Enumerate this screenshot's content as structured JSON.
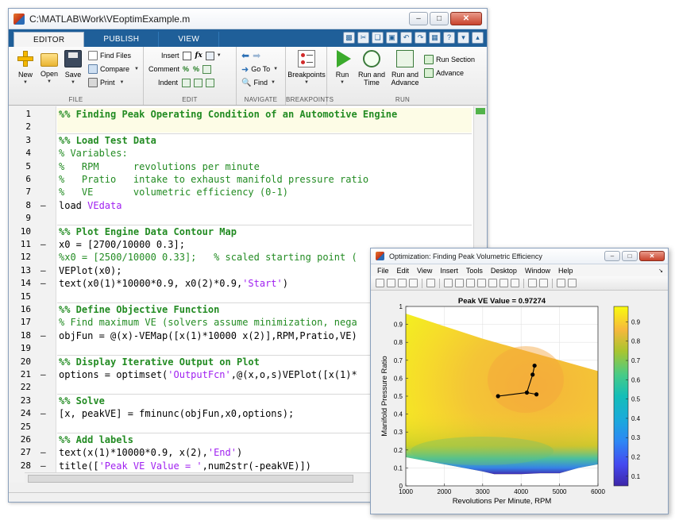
{
  "editor_window": {
    "title": "C:\\MATLAB\\Work\\VEoptimExample.m",
    "tabs": [
      {
        "label": "EDITOR",
        "active": true
      },
      {
        "label": "PUBLISH",
        "active": false
      },
      {
        "label": "VIEW",
        "active": false
      }
    ],
    "ribbon": {
      "file": {
        "group_label": "FILE",
        "new_label": "New",
        "open_label": "Open",
        "save_label": "Save",
        "find_files_label": "Find Files",
        "compare_label": "Compare",
        "print_label": "Print"
      },
      "edit": {
        "group_label": "EDIT",
        "insert_label": "Insert",
        "comment_label": "Comment",
        "indent_label": "Indent",
        "fx_label": "fx"
      },
      "navigate": {
        "group_label": "NAVIGATE",
        "goto_label": "Go To",
        "find_label": "Find"
      },
      "breakpoints": {
        "group_label": "BREAKPOINTS",
        "breakpoints_label": "Breakpoints"
      },
      "run": {
        "group_label": "RUN",
        "run_label": "Run",
        "run_and_time_line1": "Run and",
        "run_and_time_line2": "Time",
        "run_and_advance_line1": "Run and",
        "run_and_advance_line2": "Advance",
        "run_section_label": "Run Section",
        "advance_label": "Advance"
      }
    },
    "code_lines": [
      {
        "num": "1",
        "dash": false,
        "text": "%% Finding Peak Operating Condition of an Automotive Engine",
        "kind": "cell"
      },
      {
        "num": "2",
        "dash": false,
        "text": "",
        "kind": "code"
      },
      {
        "num": "3",
        "dash": false,
        "text": "%% Load Test Data",
        "kind": "cell"
      },
      {
        "num": "4",
        "dash": false,
        "text": "% Variables:",
        "kind": "comment"
      },
      {
        "num": "5",
        "dash": false,
        "text": "%   RPM      revolutions per minute",
        "kind": "comment"
      },
      {
        "num": "6",
        "dash": false,
        "text": "%   Pratio   intake to exhaust manifold pressure ratio",
        "kind": "comment"
      },
      {
        "num": "7",
        "dash": false,
        "text": "%   VE       volumetric efficiency (0-1)",
        "kind": "comment"
      },
      {
        "num": "8",
        "dash": true,
        "parts": [
          {
            "t": "load ",
            "k": "code"
          },
          {
            "t": "VEdata",
            "k": "string"
          }
        ],
        "kind": "mixed"
      },
      {
        "num": "9",
        "dash": false,
        "text": "",
        "kind": "code"
      },
      {
        "num": "10",
        "dash": false,
        "text": "%% Plot Engine Data Contour Map",
        "kind": "cell"
      },
      {
        "num": "11",
        "dash": true,
        "text": "x0 = [2700/10000 0.3];",
        "kind": "code"
      },
      {
        "num": "12",
        "dash": false,
        "text": "%x0 = [2500/10000 0.33];   % scaled starting point (",
        "kind": "comment"
      },
      {
        "num": "13",
        "dash": true,
        "text": "VEPlot(x0);",
        "kind": "code"
      },
      {
        "num": "14",
        "dash": true,
        "parts": [
          {
            "t": "text(x0(1)*10000*0.9, x0(2)*0.9,",
            "k": "code"
          },
          {
            "t": "'Start'",
            "k": "string"
          },
          {
            "t": ")",
            "k": "code"
          }
        ],
        "kind": "mixed"
      },
      {
        "num": "15",
        "dash": false,
        "text": "",
        "kind": "code"
      },
      {
        "num": "16",
        "dash": false,
        "text": "%% Define Objective Function",
        "kind": "cell"
      },
      {
        "num": "17",
        "dash": false,
        "text": "% Find maximum VE (solvers assume minimization, nega",
        "kind": "comment"
      },
      {
        "num": "18",
        "dash": true,
        "text": "objFun = @(x)-VEMap([x(1)*10000 x(2)],RPM,Pratio,VE)",
        "kind": "code"
      },
      {
        "num": "19",
        "dash": false,
        "text": "",
        "kind": "code"
      },
      {
        "num": "20",
        "dash": false,
        "text": "%% Display Iterative Output on Plot",
        "kind": "cell"
      },
      {
        "num": "21",
        "dash": true,
        "parts": [
          {
            "t": "options = optimset(",
            "k": "code"
          },
          {
            "t": "'OutputFcn'",
            "k": "string"
          },
          {
            "t": ",@(x,o,s)VEPlot([x(1)*",
            "k": "code"
          }
        ],
        "kind": "mixed"
      },
      {
        "num": "22",
        "dash": false,
        "text": "",
        "kind": "code"
      },
      {
        "num": "23",
        "dash": false,
        "text": "%% Solve",
        "kind": "cell"
      },
      {
        "num": "24",
        "dash": true,
        "text": "[x, peakVE] = fminunc(objFun,x0,options);",
        "kind": "code"
      },
      {
        "num": "25",
        "dash": false,
        "text": "",
        "kind": "code"
      },
      {
        "num": "26",
        "dash": false,
        "text": "%% Add labels",
        "kind": "cell"
      },
      {
        "num": "27",
        "dash": true,
        "parts": [
          {
            "t": "text(x(1)*10000*0.9, x(2),",
            "k": "code"
          },
          {
            "t": "'End'",
            "k": "string"
          },
          {
            "t": ")",
            "k": "code"
          }
        ],
        "kind": "mixed"
      },
      {
        "num": "28",
        "dash": true,
        "parts": [
          {
            "t": "title([",
            "k": "code"
          },
          {
            "t": "'Peak VE Value = '",
            "k": "string"
          },
          {
            "t": ",num2str(-peakVE)])",
            "k": "code"
          }
        ],
        "kind": "mixed"
      }
    ]
  },
  "figure_window": {
    "title": "Optimization: Finding Peak Volumetric Efficiency",
    "menu": [
      "File",
      "Edit",
      "View",
      "Insert",
      "Tools",
      "Desktop",
      "Window",
      "Help"
    ],
    "toolbar_icons": [
      "new-figure-icon",
      "open-icon",
      "save-icon",
      "print-icon",
      "pointer-icon",
      "zoom-in-icon",
      "zoom-out-icon",
      "pan-icon",
      "rotate-icon",
      "data-cursor-icon",
      "brush-icon",
      "link-icon",
      "colorbar-icon",
      "legend-icon",
      "hide-tools-icon",
      "show-tools-icon"
    ]
  },
  "colors": {
    "matlab_blue": "#1f5f99",
    "comment_green": "#228b22",
    "string_purple": "#a020f0"
  },
  "chart_data": {
    "type": "heatmap",
    "title": "Peak VE Value = 0.97274",
    "xlabel": "Revolutions Per Minute, RPM",
    "ylabel": "Manifold Pressure Ratio",
    "xlim": [
      1000,
      6000
    ],
    "ylim": [
      0,
      1
    ],
    "xticks": [
      1000,
      2000,
      3000,
      4000,
      5000,
      6000
    ],
    "yticks": [
      0,
      0.1,
      0.2,
      0.3,
      0.4,
      0.5,
      0.6,
      0.7,
      0.8,
      0.9,
      1
    ],
    "grid": true,
    "colorbar": {
      "ticks": [
        0.1,
        0.2,
        0.3,
        0.4,
        0.5,
        0.6,
        0.7,
        0.8,
        0.9
      ],
      "range": [
        0.05,
        0.98
      ],
      "colormap": "parula"
    },
    "domain_top": {
      "x": [
        1000,
        2000,
        3000,
        4000,
        5000,
        6000
      ],
      "y": [
        0.96,
        0.89,
        0.82,
        0.76,
        0.7,
        0.64
      ]
    },
    "domain_bottom": {
      "x": [
        1000,
        1500,
        2000,
        2500,
        3000,
        3300,
        4000,
        4500,
        5000,
        5500,
        6000
      ],
      "y": [
        0.16,
        0.14,
        0.12,
        0.1,
        0.08,
        0.065,
        0.065,
        0.07,
        0.07,
        0.1,
        0.12
      ]
    },
    "series": [
      {
        "values_x": [
          3400,
          4150,
          4300,
          4350,
          4400
        ],
        "values_y": [
          0.5,
          0.52,
          0.62,
          0.67,
          0.51
        ]
      }
    ]
  }
}
